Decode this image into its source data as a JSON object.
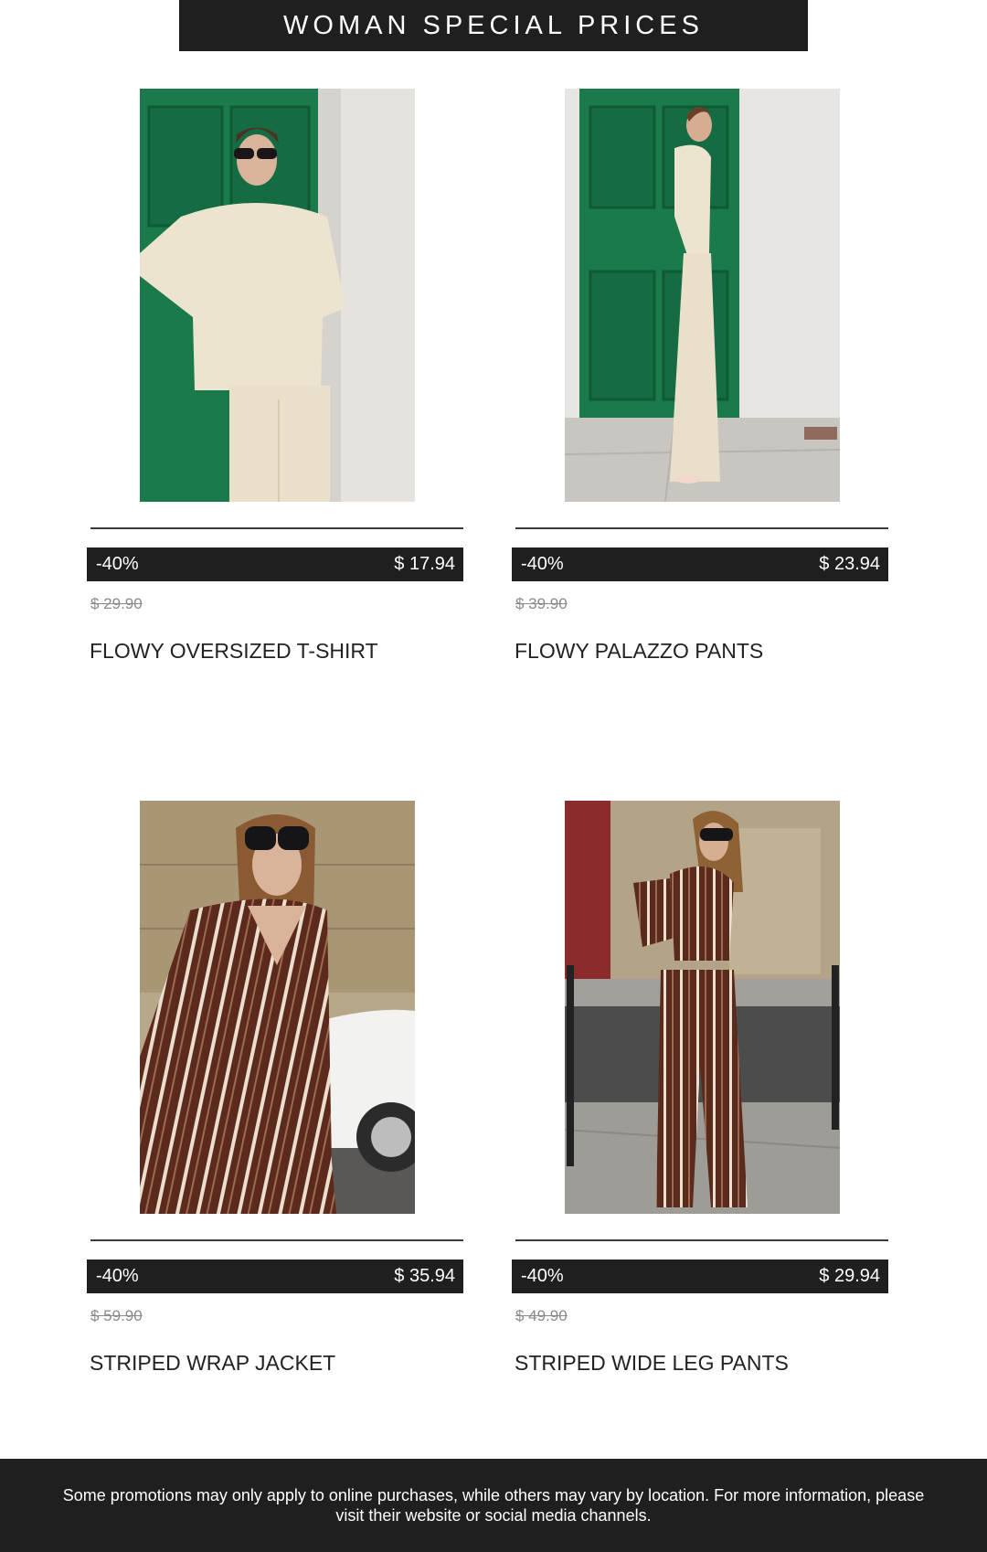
{
  "header": {
    "title": "WOMAN SPECIAL PRICES"
  },
  "products": [
    {
      "discount": "-40%",
      "price": "$ 17.94",
      "original_price": "$ 29.90",
      "name": "FLOWY OVERSIZED T-SHIRT"
    },
    {
      "discount": "-40%",
      "price": "$ 23.94",
      "original_price": "$ 39.90",
      "name": "FLOWY PALAZZO PANTS"
    },
    {
      "discount": "-40%",
      "price": "$ 35.94",
      "original_price": "$ 59.90",
      "name": "STRIPED WRAP JACKET"
    },
    {
      "discount": "-40%",
      "price": "$ 29.94",
      "original_price": "$ 49.90",
      "name": "STRIPED WIDE LEG PANTS"
    }
  ],
  "footer": {
    "disclaimer": "Some promotions may only apply to online purchases, while others may vary by location. For more information, please visit their website or social media channels."
  },
  "colors": {
    "bar_background": "#1f1f1f",
    "text_primary": "#222222",
    "text_muted": "#8a8a8a"
  }
}
